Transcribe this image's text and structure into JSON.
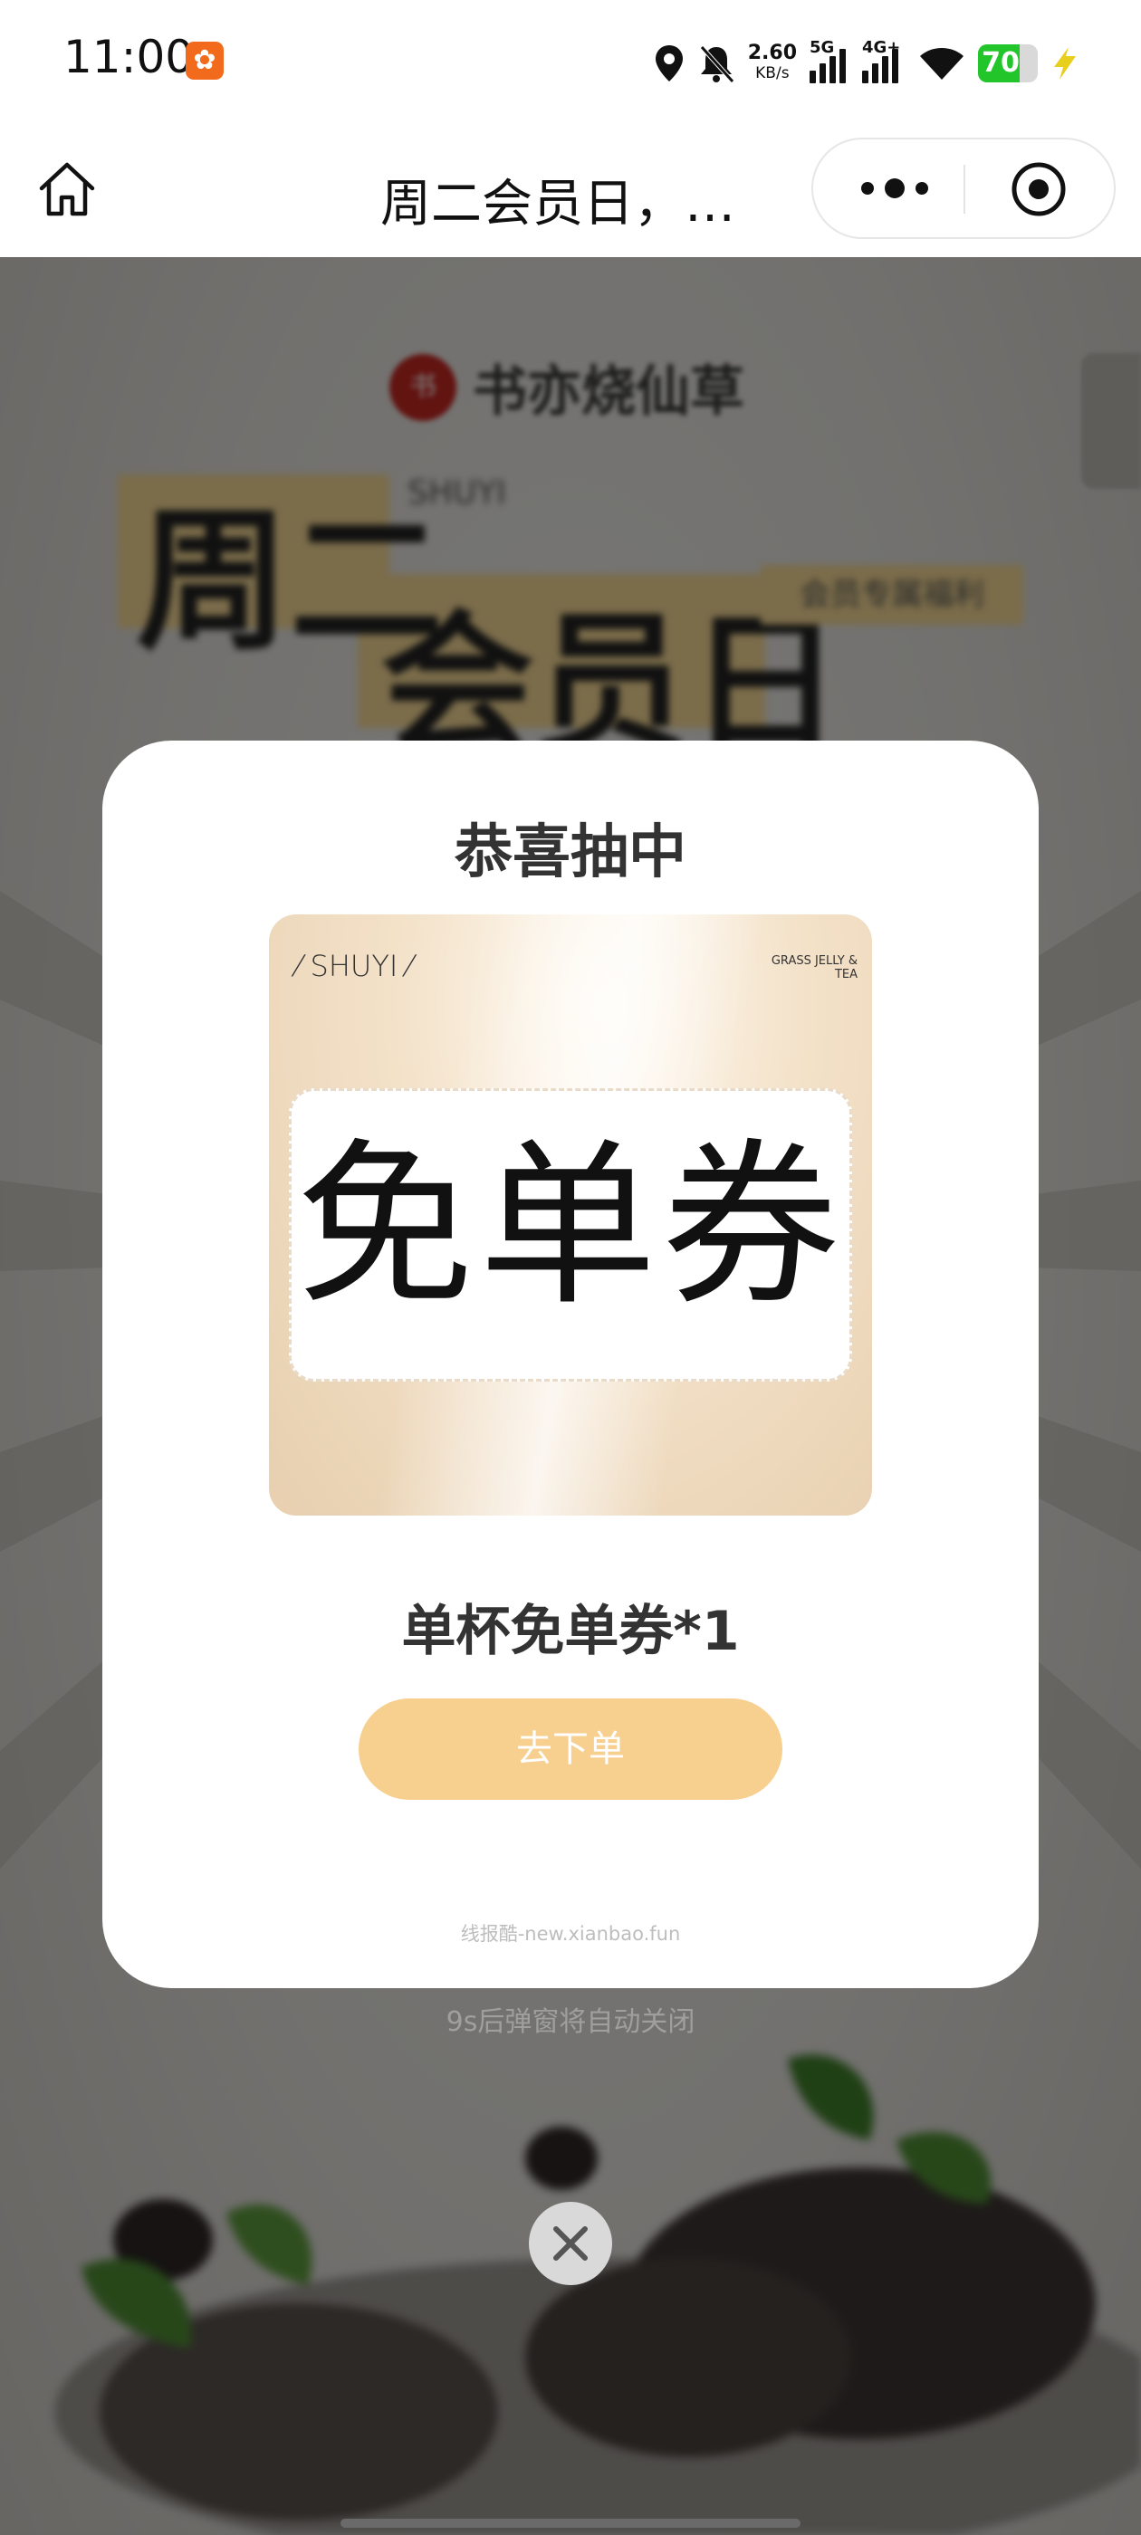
{
  "status_bar": {
    "time": "11:00",
    "net_speed": "2.60",
    "net_speed_unit": "KB/s",
    "sim1_label": "5G",
    "sim2_label": "4G+",
    "battery_level": "70",
    "battery_fraction": 0.7,
    "app_badge_icon": "paw-app-icon"
  },
  "nav": {
    "title": "周二会员日，…"
  },
  "background": {
    "brand_name": "书亦烧仙草",
    "hero_line1": "周二",
    "hero_line2": "会员日",
    "hero_tag": "SHUYI",
    "hero_ribbon": "会员专属福利"
  },
  "modal": {
    "title": "恭喜抽中",
    "coupon": {
      "brand_left": "SHUYI",
      "brand_right": "GRASS JELLY & TEA",
      "ticket_text": "免单券"
    },
    "prize_name": "单杯免单券*1",
    "order_button_label": "去下单",
    "watermark": "线报酷-new.xianbao.fun"
  },
  "auto_close_text": "9s后弹窗将自动关闭",
  "colors": {
    "accent_button": "#f7cf8e",
    "battery_green": "#22c52a",
    "app_badge": "#f26a1b"
  }
}
